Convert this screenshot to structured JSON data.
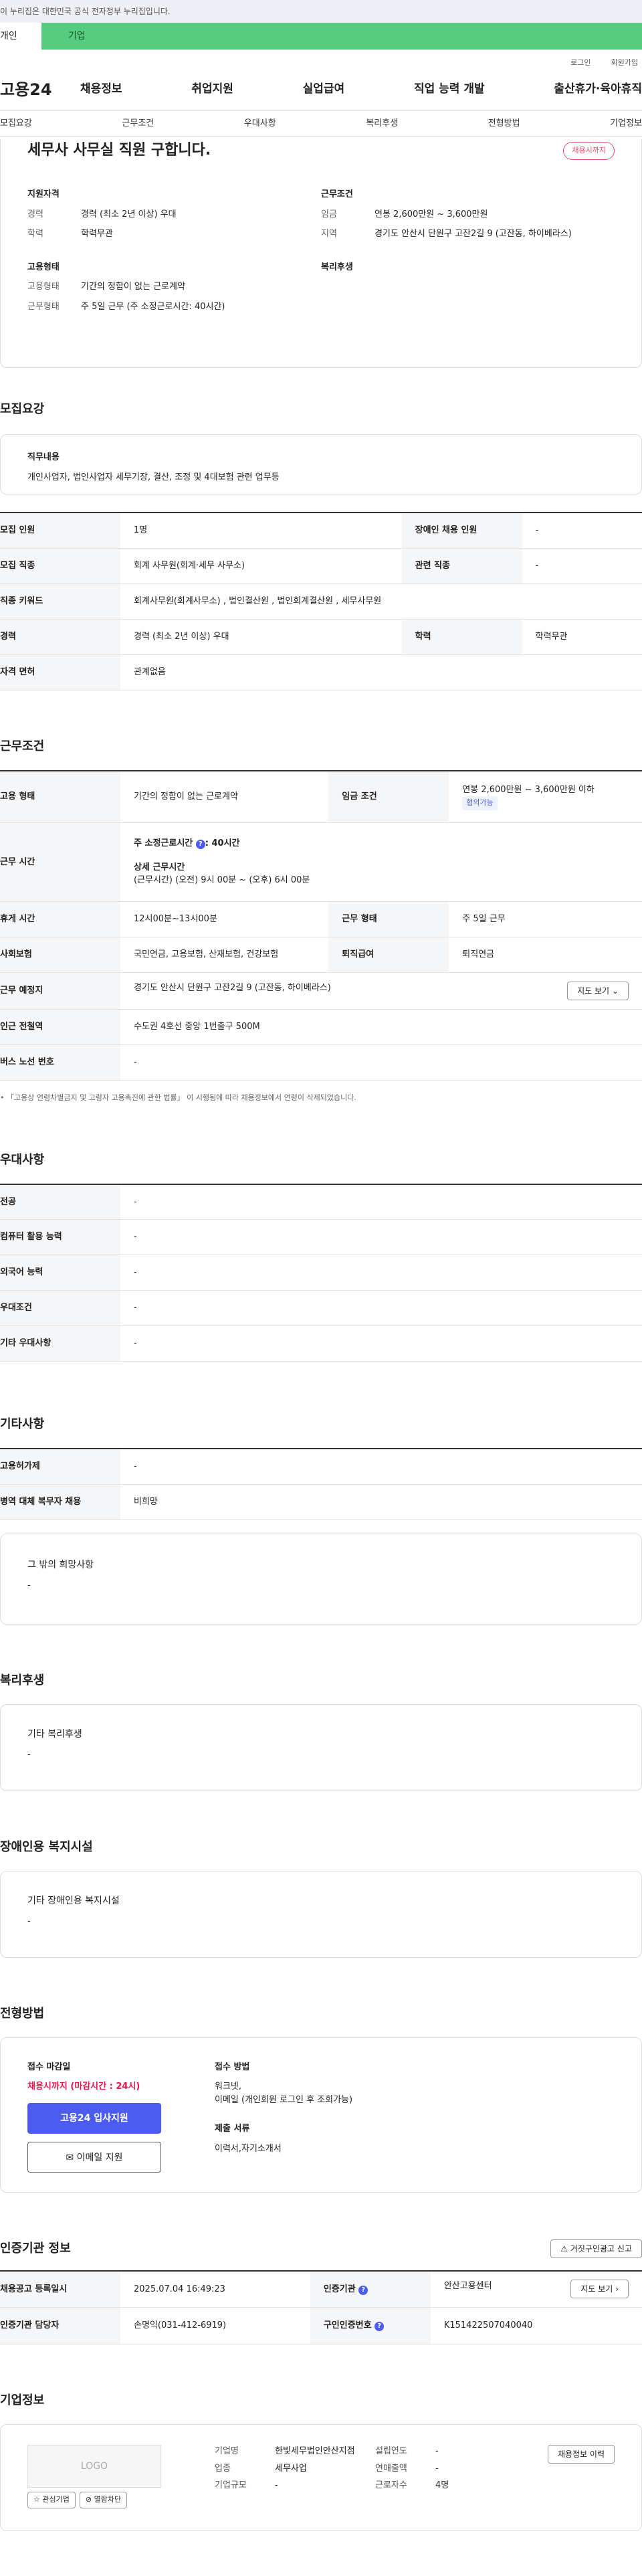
{
  "banner": "이 누리집은 대한민국 공식 전자정부 누리집입니다.",
  "topbar": {
    "tab1": "개인",
    "tab2": "기업"
  },
  "util": {
    "login": "로그인",
    "signup": "회원가입"
  },
  "gnb": {
    "logo": "고용24",
    "menu": [
      "채용정보",
      "취업지원",
      "실업급여",
      "직업 능력 개발",
      "출산휴가·육아휴직"
    ]
  },
  "subtabs": [
    "모집요강",
    "근무조건",
    "우대사항",
    "복리후생",
    "전형방법",
    "기업정보"
  ],
  "summary": {
    "title": "세무사 사무실 직원 구합니다.",
    "badge": "채용시까지",
    "qual_h": "지원자격",
    "career_k": "경력",
    "career_v": "경력 (최소 2년 이상) 우대",
    "edu_k": "학력",
    "edu_v": "학력무관",
    "work_h": "근무조건",
    "wage_k": "임금",
    "wage_v": "연봉 2,600만원 ~ 3,600만원",
    "region_k": "지역",
    "region_v": "경기도 안산시 단원구 고잔2길 9 (고잔동, 하이베라스)",
    "emp_h": "고용형태",
    "emptype_k": "고용형태",
    "emptype_v": "기간의 정함이 없는 근로계약",
    "worktype_k": "근무형태",
    "worktype_v": "주 5일 근무 (주 소정근로시간: 40시간)",
    "welfare_h": "복리후생"
  },
  "recruit": {
    "title": "모집요강",
    "duty_h": "직무내용",
    "duty_v": "개인사업자, 법인사업자 세무기장, 결산, 조정 및 4대보험 관련 업무등",
    "rows": {
      "count_k": "모집 인원",
      "count_v": "1명",
      "disabled_k": "장애인 채용 인원",
      "disabled_v": "-",
      "job_k": "모집 직종",
      "job_v": "회계 사무원(회계·세무 사무소)",
      "related_k": "관련 직종",
      "related_v": "-",
      "kw_k": "직종 키워드",
      "kw_v": "회계사무원(회계사무소) , 법인결산원 , 법인회계결산원 , 세무사무원",
      "exp_k": "경력",
      "exp_v": "경력 (최소 2년 이상) 우대",
      "edu_k": "학력",
      "edu_v": "학력무관",
      "license_k": "자격 면허",
      "license_v": "관계없음"
    }
  },
  "conditions": {
    "title": "근무조건",
    "emptype_k": "고용 형태",
    "emptype_v": "기간의 정함이 없는 근로계약",
    "wage_k": "임금 조건",
    "wage_v": "연봉 2,600만원 ~ 3,600만원 이하",
    "wage_tag": "협의가능",
    "hours_k": "근무 시간",
    "hours_week": "주 소정근로시간",
    "hours_week_v": ": 40시간",
    "hours_detail_h": "상세 근무시간",
    "hours_detail_v": "(근무시간) (오전) 9시 00분 ~ (오후) 6시 00분",
    "rest_k": "휴게 시간",
    "rest_v": "12시00분~13시00분",
    "worktype_k": "근무 형태",
    "worktype_v": "주 5일 근무",
    "insurance_k": "사회보험",
    "insurance_v": "국민연금, 고용보험, 산재보험, 건강보험",
    "severance_k": "퇴직급여",
    "severance_v": "퇴직연금",
    "place_k": "근무 예정지",
    "place_v": "경기도 안산시 단원구 고잔2길 9 (고잔동, 하이베라스)",
    "map_btn": "지도 보기",
    "subway_k": "인근 전철역",
    "subway_v": "수도권 4호선 중앙 1번출구 500M",
    "bus_k": "버스 노선 번호",
    "bus_v": "-",
    "note": "「고용상 연령차별금지 및 고령자 고용촉진에 관한 법률」 이 시행됨에 따라 채용정보에서 연령이 삭제되었습니다."
  },
  "preference": {
    "title": "우대사항",
    "rows": [
      {
        "k": "전공",
        "v": "-"
      },
      {
        "k": "컴퓨터 활용 능력",
        "v": "-"
      },
      {
        "k": "외국어 능력",
        "v": "-"
      },
      {
        "k": "우대조건",
        "v": "-"
      },
      {
        "k": "기타 우대사항",
        "v": "-"
      }
    ]
  },
  "etc": {
    "title": "기타사항",
    "rows": [
      {
        "k": "고용허가제",
        "v": "-"
      },
      {
        "k": "병역 대체 복무자 채용",
        "v": "비희망"
      }
    ],
    "other_h": "그 밖의 희망사항",
    "other_v": "-"
  },
  "welfare": {
    "title": "복리후생",
    "box_h": "기타 복리후생",
    "box_v": "-"
  },
  "disability": {
    "title": "장애인용 복지시설",
    "box_h": "기타 장애인용 복지시설",
    "box_v": "-"
  },
  "process": {
    "title": "전형방법",
    "deadline_h": "접수 마감일",
    "deadline_v": "채용시까지 (마감시간 : 24시)",
    "apply_btn": "고용24 입사지원",
    "email_btn": "이메일 지원",
    "method_h": "접수 방법",
    "method_v1": "워크넷,",
    "method_v2": "이메일 (개인회원 로그인 후 조회가능)",
    "docs_h": "제출 서류",
    "docs_v": "이력서,자기소개서"
  },
  "agency": {
    "title": "인증기관 정보",
    "report_btn": "거짓구인광고 신고",
    "reg_k": "채용공고 등록일시",
    "reg_v": "2025.07.04 16:49:23",
    "agency_k": "인증기관",
    "agency_v": "안산고용센터",
    "map_btn": "지도 보기",
    "manager_k": "인증기관 담당자",
    "manager_v": "손명익(031-412-6919)",
    "no_k": "구인인증번호",
    "no_v": "K151422507040040"
  },
  "company": {
    "title": "기업정보",
    "logo": "LOGO",
    "interest_btn": "관심기업",
    "block_btn": "열람차단",
    "name_k": "기업명",
    "name_v": "한빛세무법인안산지점",
    "industry_k": "업종",
    "industry_v": "세무사업",
    "scale_k": "기업규모",
    "scale_v": "-",
    "founded_k": "설립연도",
    "founded_v": "-",
    "sales_k": "연매출액",
    "sales_v": "-",
    "staff_k": "근로자수",
    "staff_v": "4명",
    "history_btn": "채용정보 이력"
  }
}
